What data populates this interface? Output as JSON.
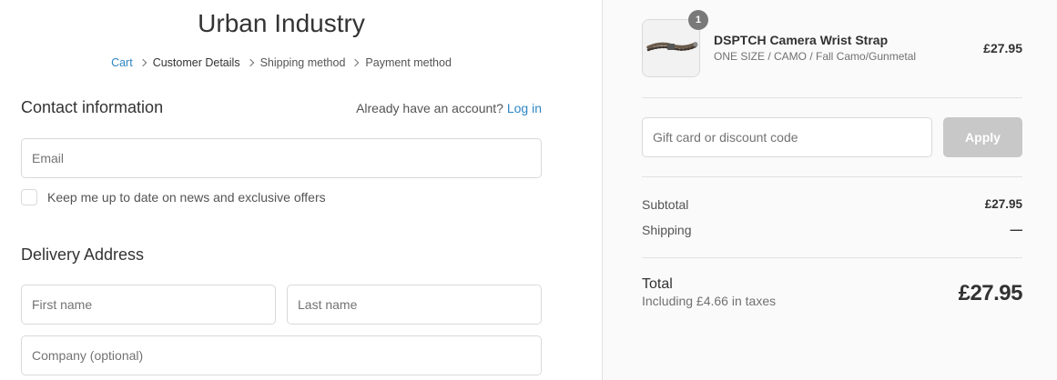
{
  "shop": {
    "title": "Urban Industry"
  },
  "breadcrumb": [
    {
      "label": "Cart",
      "state": "link"
    },
    {
      "label": "Customer Details",
      "state": "current"
    },
    {
      "label": "Shipping method",
      "state": "upcoming"
    },
    {
      "label": "Payment method",
      "state": "upcoming"
    }
  ],
  "contact": {
    "title": "Contact information",
    "account_prompt": "Already have an account?",
    "login_label": "Log in",
    "email_placeholder": "Email",
    "email_value": "",
    "newsletter_label": "Keep me up to date on news and exclusive offers",
    "newsletter_checked": false
  },
  "delivery": {
    "title": "Delivery Address",
    "first_name_placeholder": "First name",
    "last_name_placeholder": "Last name",
    "company_placeholder": "Company (optional)"
  },
  "order": {
    "product": {
      "name": "DSPTCH Camera Wrist Strap",
      "variant": "ONE SIZE / CAMO / Fall Camo/Gunmetal",
      "price": "£27.95",
      "quantity": "1",
      "image_icon": "wrist-strap-product-image"
    },
    "discount": {
      "placeholder": "Gift card or discount code",
      "value": "",
      "apply_label": "Apply"
    },
    "subtotal_label": "Subtotal",
    "subtotal_value": "£27.95",
    "shipping_label": "Shipping",
    "shipping_value": "—",
    "total_label": "Total",
    "taxes_note": "Including £4.66 in taxes",
    "total_value": "£27.95"
  },
  "colors": {
    "link": "#2d86c4",
    "apply_disabled": "#c8c8c8",
    "sidebar_bg": "#fafafa"
  }
}
